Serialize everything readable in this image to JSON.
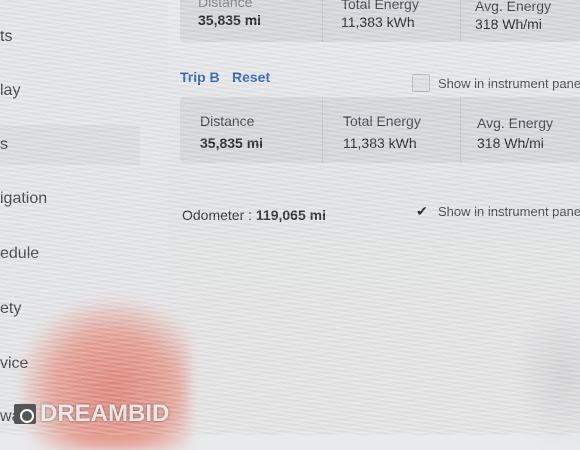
{
  "sidebar": {
    "items": [
      {
        "label": "ts"
      },
      {
        "label": "lay"
      },
      {
        "label": "s"
      },
      {
        "label": "igation"
      },
      {
        "label": "edule"
      },
      {
        "label": "ety"
      },
      {
        "label": "vice"
      },
      {
        "label": "ware"
      }
    ]
  },
  "trip_a": {
    "distance_label": "Distance",
    "distance_value": "35,835 mi",
    "energy_label": "Total Energy",
    "energy_value": "11,383 kWh",
    "avg_label": "Avg. Energy",
    "avg_value": "318 Wh/mi"
  },
  "trip_b": {
    "title": "Trip B",
    "reset_label": "Reset",
    "show_label": "Show in instrument panel",
    "show_checked": false,
    "distance_label": "Distance",
    "distance_value": "35,835 mi",
    "energy_label": "Total Energy",
    "energy_value": "11,383 kWh",
    "avg_label": "Avg. Energy",
    "avg_value": "318 Wh/mi"
  },
  "odometer": {
    "label": "Odometer :",
    "value": "119,065 mi",
    "show_label": "Show in instrument panel",
    "show_checked": true
  },
  "watermark": {
    "text": "DREAMBID"
  }
}
